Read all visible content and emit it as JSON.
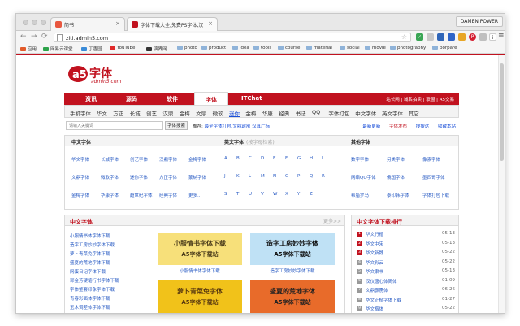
{
  "browser": {
    "tabs": [
      {
        "title": "简书",
        "favicon_color": "#e8573f"
      },
      {
        "title": "字体下载大全,免费PS字体,汉",
        "favicon_color": "#c1121f"
      }
    ],
    "profile": "DAMEN POWER",
    "url": "ziti.admin5.com",
    "bookmarks": [
      "应用",
      "网易云课堂",
      "丁香园",
      "YouTube",
      "演界网",
      "photo",
      "product",
      "idea",
      "tools",
      "course",
      "material",
      "social",
      "movie",
      "photography",
      "porpare"
    ]
  },
  "site": {
    "logo_text": "字体",
    "logo_sub": "admin5.com",
    "main_nav": [
      "资讯",
      "源码",
      "软件",
      "字体",
      "ITChat"
    ],
    "main_nav_active": "字体",
    "main_nav_right": "站长网 | 域名拍卖 | 联盟 | A5交易",
    "sub_nav": [
      "手机字体",
      "华文",
      "方正",
      "长城",
      "创艺",
      "汉鼎",
      "金梅",
      "文鼎",
      "微软",
      "迷你",
      "金梅",
      "华康",
      "经典",
      "书法",
      "QQ",
      "字体打包",
      "中文字体",
      "英文字体",
      "其它"
    ],
    "sub_nav_highlight": "迷你",
    "search": {
      "placeholder": "请输入关键词",
      "button": "字体搜索",
      "hot_label": "推荐:",
      "hot_items": "最全字体打包 文鼎霹雳 汉真广标"
    },
    "right_links": [
      "最新更新",
      "字体发布",
      "搜搜这",
      "收藏本站"
    ],
    "right_links_highlight": "字体发布"
  },
  "categories": {
    "zh": {
      "title": "中文字体",
      "items": [
        "华文字体",
        "长城字体",
        "创艺字体",
        "汉鼎字体",
        "金梅字体",
        "文鼎字体",
        "微软字体",
        "迷你字体",
        "方正字体",
        "蒙纳字体",
        "金梅字体",
        "华康字体",
        "超世纪字体",
        "经典字体",
        "更多..."
      ]
    },
    "en": {
      "title": "英文字体",
      "subtitle": "(按字母检索)",
      "letters": [
        "A",
        "B",
        "C",
        "D",
        "E",
        "F",
        "G",
        "H",
        "I",
        "J",
        "K",
        "L",
        "M",
        "N",
        "O",
        "P",
        "Q",
        "R",
        "S",
        "T",
        "U",
        "V",
        "W",
        "X",
        "Y",
        "Z"
      ]
    },
    "other": {
      "title": "其他字体",
      "items": [
        "数字字体",
        "另类字体",
        "像素字体",
        "网络QQ字体",
        "俄国字体",
        "墨西哥字体",
        "希腊罗马",
        "泰印韩字体",
        "字体打包下载"
      ]
    }
  },
  "zh_section": {
    "title": "中文字体",
    "more": "更多>>",
    "list": [
      "小服情书体字体下载",
      "造字工房妙妙字体下载",
      "萝卜青菜免字体下载",
      "盛夏的荒地字体下载",
      "网蛋日记字体下载",
      "郭金芳硬笔行书字体下载",
      "字体整套印象字体下载",
      "青春彩面体字体下载",
      "玉木调差体字体下载"
    ],
    "thumbs": [
      {
        "text1": "小服情书字体下载",
        "text2": "A5字体下载站",
        "caption": "小服情书体字体下载",
        "bg": "#f7e07a",
        "fg": "#4a3b1a"
      },
      {
        "text1": "造字工房妙妙字体",
        "text2": "A5字体下载站",
        "caption": "造字工房妙妙字体下载",
        "bg": "#bfe1f5",
        "fg": "#111"
      },
      {
        "text1": "萝卜青菜免字体",
        "text2": "A5字体下载站",
        "caption": "",
        "bg": "#f1c21a",
        "fg": "#5a3a10"
      },
      {
        "text1": "盛夏的荒地字体",
        "text2": "A5字体下载站",
        "caption": "",
        "bg": "#e86b2a",
        "fg": "#222"
      }
    ]
  },
  "ranking": {
    "title": "中文字体下载排行",
    "rows": [
      {
        "num": "1",
        "name": "华文行楷",
        "date": "05-13"
      },
      {
        "num": "2",
        "name": "华文中宋",
        "date": "05-13"
      },
      {
        "num": "3",
        "name": "华文新魏",
        "date": "05-22"
      },
      {
        "num": "4",
        "name": "华文彩云",
        "date": "05-22"
      },
      {
        "num": "5",
        "name": "华文隶书",
        "date": "05-13"
      },
      {
        "num": "6",
        "name": "汉仪唐心体简体",
        "date": "01-09"
      },
      {
        "num": "7",
        "name": "文鼎霹雳体",
        "date": "06-26"
      },
      {
        "num": "8",
        "name": "华文正楷字体下载",
        "date": "01-27"
      },
      {
        "num": "9",
        "name": "华文楷体",
        "date": "05-22"
      }
    ]
  }
}
